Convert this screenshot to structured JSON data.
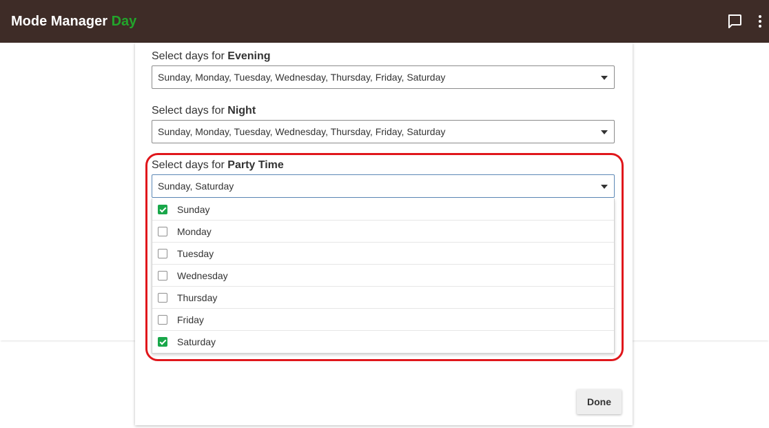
{
  "header": {
    "app_title": "Mode Manager",
    "current_mode": "Day",
    "mode_color": "#22a52b",
    "bar_color": "#3e2c27",
    "icons": [
      "chat-icon",
      "more-vert-icon"
    ]
  },
  "fields": [
    {
      "label_prefix": "Select days for ",
      "mode": "Evening",
      "value": "Sunday, Monday, Tuesday, Wednesday, Thursday, Friday, Saturday"
    },
    {
      "label_prefix": "Select days for ",
      "mode": "Night",
      "value": "Sunday, Monday, Tuesday, Wednesday, Thursday, Friday, Saturday"
    },
    {
      "label_prefix": "Select days for ",
      "mode": "Party Time",
      "value": "Sunday, Saturday"
    }
  ],
  "dropdown": {
    "options": [
      {
        "label": "Sunday",
        "checked": true
      },
      {
        "label": "Monday",
        "checked": false
      },
      {
        "label": "Tuesday",
        "checked": false
      },
      {
        "label": "Wednesday",
        "checked": false
      },
      {
        "label": "Thursday",
        "checked": false
      },
      {
        "label": "Friday",
        "checked": false
      },
      {
        "label": "Saturday",
        "checked": true
      }
    ],
    "check_color": "#19a74a"
  },
  "highlight_color": "#e0161b",
  "done_label": "Done"
}
